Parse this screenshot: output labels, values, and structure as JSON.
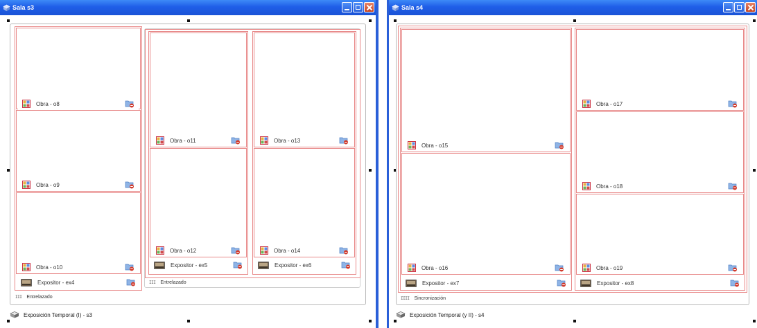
{
  "colors": {
    "titlebar": "#2a5fd8",
    "box_border": "#e88888",
    "accent": "#1f5ee8"
  },
  "windows": [
    {
      "title": "Sala s3",
      "outer_layout": "Entrelazado",
      "inner_layout": "Entrelazado",
      "footer": "Exposición Temporal (I) - s3",
      "left_column": [
        "Obra - o8",
        "Obra - o9",
        "Obra - o10"
      ],
      "left_expositor": "Expositor - ex4",
      "col_a": [
        "Obra - o11",
        "Obra - o12"
      ],
      "col_a_expositor": "Expositor - ex5",
      "col_b": [
        "Obra - o13",
        "Obra - o14"
      ],
      "col_b_expositor": "Expositor - ex6"
    },
    {
      "title": "Sala s4",
      "layout": "Sincronización",
      "footer": "Exposición Temporal (y II) - s4",
      "left_column": [
        "Obra - o15",
        "Obra - o16"
      ],
      "left_expositor": "Expositor - ex7",
      "right_column": [
        "Obra - o17",
        "Obra - o18",
        "Obra - o19"
      ],
      "right_expositor": "Expositor - ex8"
    }
  ],
  "icons": {
    "window": "room-3d-icon",
    "art": "artwork-grid-icon",
    "expositor": "expositor-picture-icon",
    "delete": "folder-remove-icon",
    "layout_interlaced": "III",
    "layout_sync": "IIII"
  }
}
